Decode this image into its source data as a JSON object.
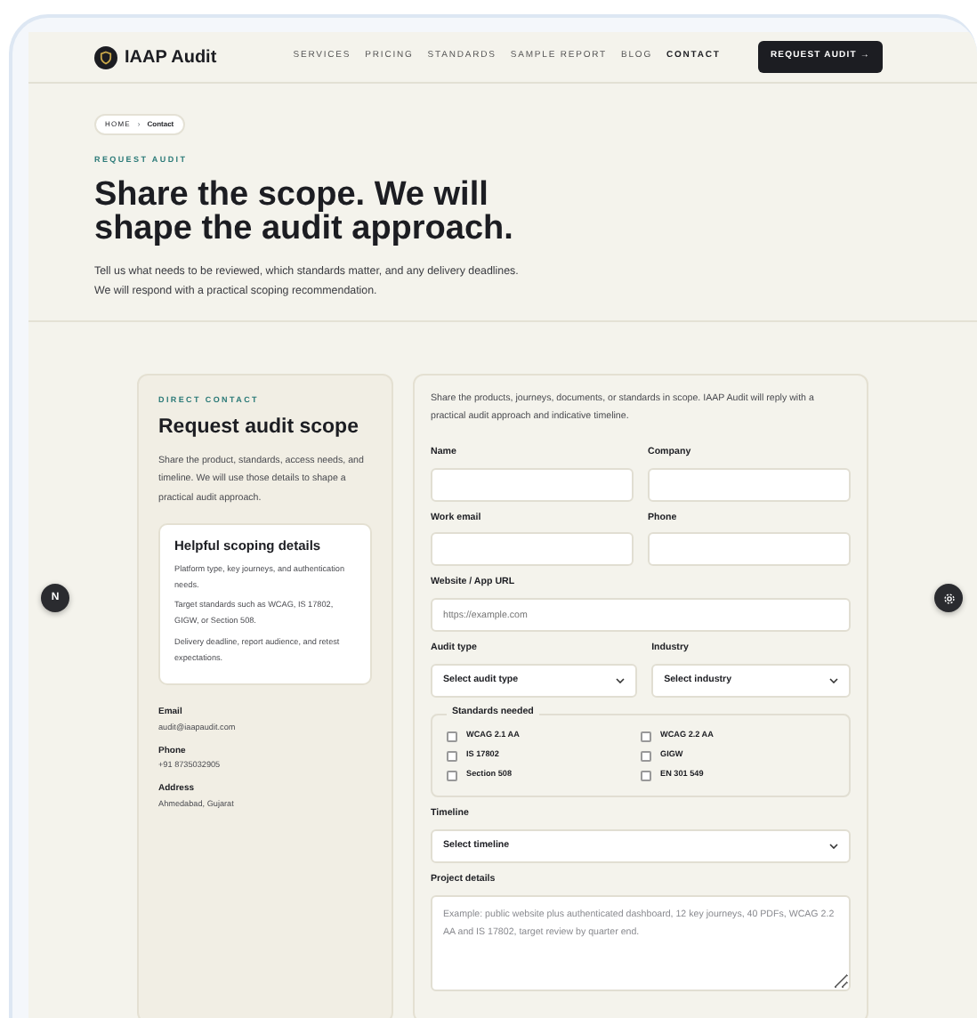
{
  "navbar": {
    "logo_text": "IAAP Audit",
    "links": [
      {
        "label": "SERVICES",
        "selected": false
      },
      {
        "label": "PRICING",
        "selected": false
      },
      {
        "label": "STANDARDS",
        "selected": false
      },
      {
        "label": "SAMPLE REPORT",
        "selected": false
      },
      {
        "label": "BLOG",
        "selected": false
      },
      {
        "label": "CONTACT",
        "selected": true
      }
    ],
    "cta": {
      "label": "REQUEST AUDIT",
      "arrow": "→"
    }
  },
  "breadcrumb": {
    "items": [
      {
        "label": "HOME"
      },
      {
        "label": "Contact"
      }
    ],
    "separator": "›"
  },
  "hero": {
    "eyebrow": "REQUEST AUDIT",
    "title": "Share the scope. We will shape the audit approach.",
    "description_lines": [
      "Tell us what needs to be reviewed, which standards matter, and any delivery deadlines.",
      "We will respond with a practical scoping recommendation."
    ]
  },
  "contact_card": {
    "eyebrow": "DIRECT CONTACT",
    "title": "Request audit scope",
    "description": "Share the product, standards, access needs, and timeline. We will use those details to shape a practical audit approach.",
    "tips": {
      "title": "Helpful scoping details",
      "items": [
        "Platform type, key journeys, and authentication needs.",
        "Target standards such as WCAG, IS 17802, GIGW, or Section 508.",
        "Delivery deadline, report audience, and retest expectations."
      ]
    },
    "details": [
      {
        "label": "Email",
        "value": "audit@iaapaudit.com"
      },
      {
        "label": "Phone",
        "value": "+91 8735032905"
      },
      {
        "label": "Address",
        "value": "Ahmedabad, Gujarat"
      }
    ]
  },
  "form": {
    "intro": "Share the products, journeys, documents, or standards in scope. IAAP Audit will reply with a practical audit approach and indicative timeline.",
    "rows": [
      [
        {
          "kind": "text",
          "label": "Name"
        },
        {
          "kind": "text",
          "label": "Company"
        }
      ],
      [
        {
          "kind": "text",
          "label": "Work email"
        },
        {
          "kind": "text",
          "label": "Phone"
        }
      ],
      [
        {
          "kind": "text",
          "label": "Website / App URL",
          "placeholder": "https://example.com"
        }
      ],
      [
        {
          "kind": "select",
          "label": "Audit type",
          "value": "Select audit type"
        },
        {
          "kind": "select",
          "label": "Industry",
          "value": "Select industry"
        }
      ],
      [
        {
          "kind": "checkgroup",
          "label": "Standards needed",
          "options": [
            {
              "label": "WCAG 2.1 AA",
              "checked": false
            },
            {
              "label": "WCAG 2.2 AA",
              "checked": false
            },
            {
              "label": "IS 17802",
              "checked": false
            },
            {
              "label": "GIGW",
              "checked": false
            },
            {
              "label": "Section 508",
              "checked": false
            },
            {
              "label": "EN 301 549",
              "checked": false
            }
          ]
        }
      ],
      [
        {
          "kind": "select",
          "label": "Timeline",
          "value": "Select timeline"
        }
      ],
      [
        {
          "kind": "textarea",
          "label": "Project details",
          "placeholder": "Example: public website plus authenticated dashboard, 12 key journeys, 40 PDFs, WCAG 2.2 AA and IS 17802, target review by quarter end."
        }
      ]
    ]
  },
  "floating": {
    "left_badge": "N"
  }
}
